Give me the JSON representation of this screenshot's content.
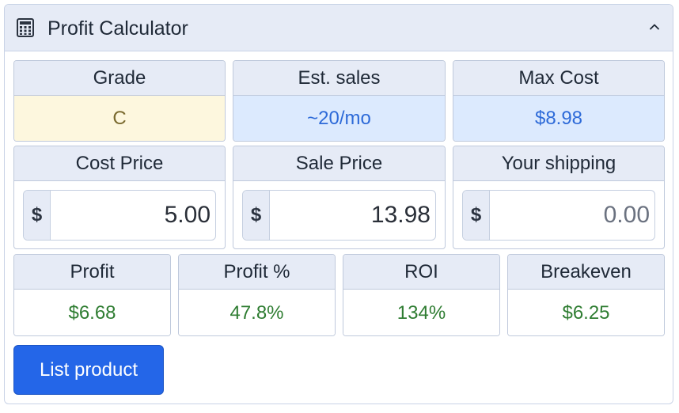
{
  "header": {
    "title": "Profit Calculator",
    "icon": "calculator-icon",
    "collapse_icon": "chevron-up-icon"
  },
  "stats_top": [
    {
      "label": "Grade",
      "value": "C"
    },
    {
      "label": "Est. sales",
      "value": "~20/mo"
    },
    {
      "label": "Max Cost",
      "value": "$8.98"
    }
  ],
  "inputs": [
    {
      "label": "Cost Price",
      "prefix": "$",
      "value": "5.00",
      "placeholder": ""
    },
    {
      "label": "Sale Price",
      "prefix": "$",
      "value": "13.98",
      "placeholder": ""
    },
    {
      "label": "Your shipping",
      "prefix": "$",
      "value": "",
      "placeholder": "0.00"
    }
  ],
  "results": [
    {
      "label": "Profit",
      "value": "$6.68"
    },
    {
      "label": "Profit %",
      "value": "47.8%"
    },
    {
      "label": "ROI",
      "value": "134%"
    },
    {
      "label": "Breakeven",
      "value": "$6.25"
    }
  ],
  "actions": {
    "list_label": "List product"
  },
  "colors": {
    "accent": "#2466e8",
    "header_bg": "#e6ebf6",
    "grade_bg": "#fdf7de",
    "info_bg": "#dceafe",
    "positive": "#2f7d32"
  }
}
